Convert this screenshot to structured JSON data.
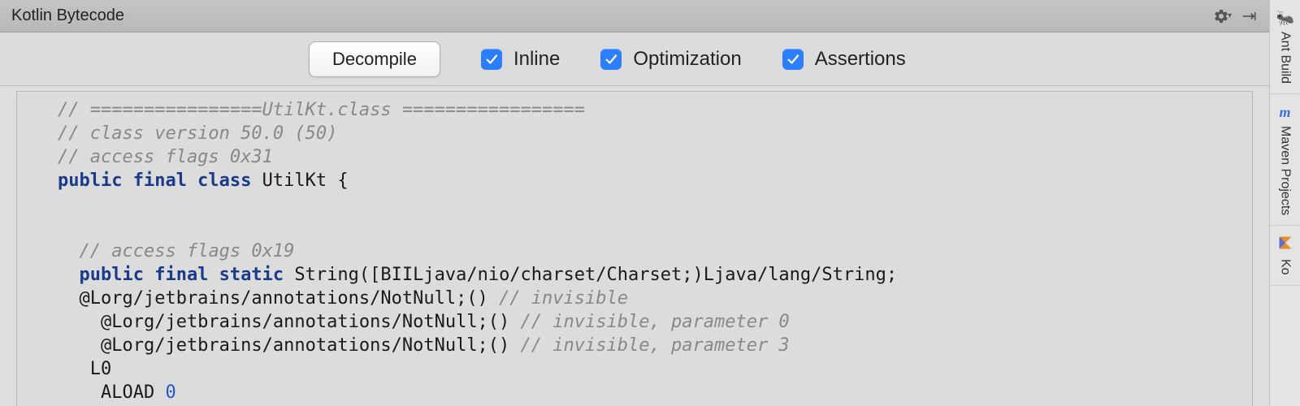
{
  "panel": {
    "title": "Kotlin Bytecode"
  },
  "toolbar": {
    "decompile_label": "Decompile",
    "checkboxes": [
      {
        "label": "Inline",
        "checked": true
      },
      {
        "label": "Optimization",
        "checked": true
      },
      {
        "label": "Assertions",
        "checked": true
      }
    ]
  },
  "editor": {
    "lines": [
      {
        "segments": [
          {
            "cls": "c-comment",
            "text": "// ================UtilKt.class ================="
          }
        ]
      },
      {
        "segments": [
          {
            "cls": "c-comment",
            "text": "// class version 50.0 (50)"
          }
        ]
      },
      {
        "segments": [
          {
            "cls": "c-comment",
            "text": "// access flags 0x31"
          }
        ]
      },
      {
        "segments": [
          {
            "cls": "c-keyword",
            "text": "public final class "
          },
          {
            "cls": "c-text",
            "text": "UtilKt {"
          }
        ]
      },
      {
        "segments": []
      },
      {
        "segments": []
      },
      {
        "segments": [
          {
            "cls": "c-text",
            "text": "  "
          },
          {
            "cls": "c-comment",
            "text": "// access flags 0x19"
          }
        ]
      },
      {
        "segments": [
          {
            "cls": "c-text",
            "text": "  "
          },
          {
            "cls": "c-keyword",
            "text": "public final static "
          },
          {
            "cls": "c-text",
            "text": "String([BIILjava/nio/charset/Charset;)Ljava/lang/String;"
          }
        ]
      },
      {
        "segments": [
          {
            "cls": "c-text",
            "text": "  @Lorg/jetbrains/annotations/NotNull;() "
          },
          {
            "cls": "c-comment",
            "text": "// invisible"
          }
        ]
      },
      {
        "segments": [
          {
            "cls": "c-text",
            "text": "    @Lorg/jetbrains/annotations/NotNull;() "
          },
          {
            "cls": "c-comment",
            "text": "// invisible, parameter 0"
          }
        ]
      },
      {
        "segments": [
          {
            "cls": "c-text",
            "text": "    @Lorg/jetbrains/annotations/NotNull;() "
          },
          {
            "cls": "c-comment",
            "text": "// invisible, parameter 3"
          }
        ]
      },
      {
        "segments": [
          {
            "cls": "c-text",
            "text": "   L0"
          }
        ]
      },
      {
        "segments": [
          {
            "cls": "c-text",
            "text": "    ALOAD "
          },
          {
            "cls": "c-num",
            "text": "0"
          }
        ]
      }
    ]
  },
  "sidebar": {
    "items": [
      {
        "label": "Ant Build",
        "icon_text": "🐜",
        "icon_name": "ant-icon"
      },
      {
        "label": "Maven Projects",
        "icon_text": "m",
        "icon_name": "maven-icon"
      },
      {
        "label": "Ko",
        "icon_text": "",
        "icon_name": "kotlin-icon"
      }
    ]
  }
}
